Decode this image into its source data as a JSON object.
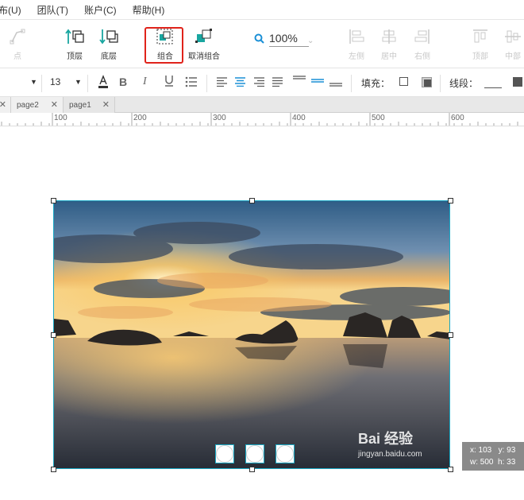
{
  "menu": [
    "布(U)",
    "团队(T)",
    "账户(C)",
    "帮助(H)"
  ],
  "toolbar": {
    "point_label": "点",
    "top_layer_label": "顶层",
    "bottom_layer_label": "底层",
    "group_label": "组合",
    "ungroup_label": "取消组合",
    "zoom_value": "100%",
    "align_left_label": "左侧",
    "align_center_label": "居中",
    "align_right_label": "右侧",
    "align_top_label": "顶部",
    "align_middle_label": "中部"
  },
  "format": {
    "font_size": "13",
    "fill_label": "填充：",
    "stroke_label": "线段："
  },
  "tabs": [
    {
      "label": "page2"
    },
    {
      "label": "page1"
    }
  ],
  "ruler": [
    "100",
    "200",
    "300",
    "400",
    "500",
    "600"
  ],
  "selection": {
    "x_text": "x: 103",
    "y_text": "y: 93",
    "w_text": "w: 500",
    "h_text": "h: 33"
  },
  "watermark": {
    "logo": "Bai 经验",
    "url": "jingyan.baidu.com"
  },
  "colors": {
    "accent": "#1aa8c4",
    "highlight": "#e0231b",
    "active_icon": "#19a6a0"
  }
}
